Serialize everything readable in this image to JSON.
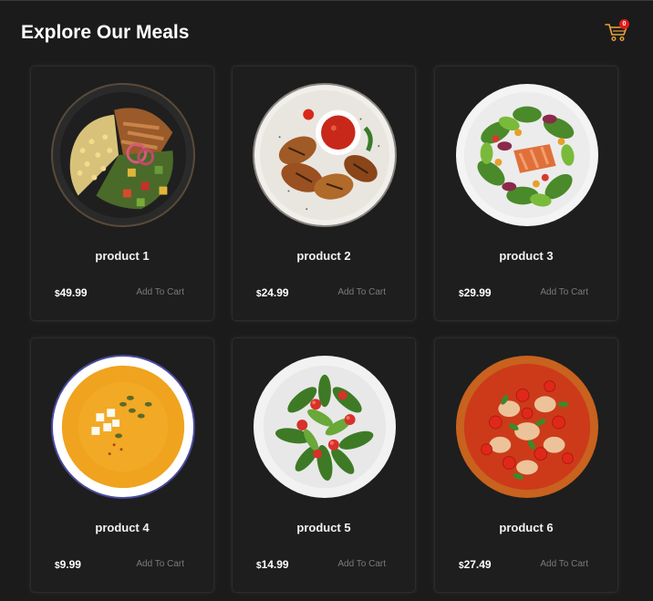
{
  "header": {
    "title": "Explore Our Meals",
    "cart_count": "0",
    "cart_icon": "shopping-cart-icon"
  },
  "colors": {
    "background": "#1b1b1b",
    "card": "#1e1e1e",
    "badge": "#e01b1b",
    "cart_icon": "#e8a43a"
  },
  "products": [
    {
      "name": "product 1",
      "currency": "$",
      "price": "49.99",
      "button": "Add To Cart",
      "image": "chicken-corn-rice-bowl"
    },
    {
      "name": "product 2",
      "currency": "$",
      "price": "24.99",
      "button": "Add To Cart",
      "image": "grilled-chicken-wings-with-sauce"
    },
    {
      "name": "product 3",
      "currency": "$",
      "price": "29.99",
      "button": "Add To Cart",
      "image": "salmon-salad"
    },
    {
      "name": "product 4",
      "currency": "$",
      "price": "9.99",
      "button": "Add To Cart",
      "image": "pumpkin-soup"
    },
    {
      "name": "product 5",
      "currency": "$",
      "price": "14.99",
      "button": "Add To Cart",
      "image": "green-salad"
    },
    {
      "name": "product 6",
      "currency": "$",
      "price": "27.49",
      "button": "Add To Cart",
      "image": "margherita-pizza"
    }
  ]
}
